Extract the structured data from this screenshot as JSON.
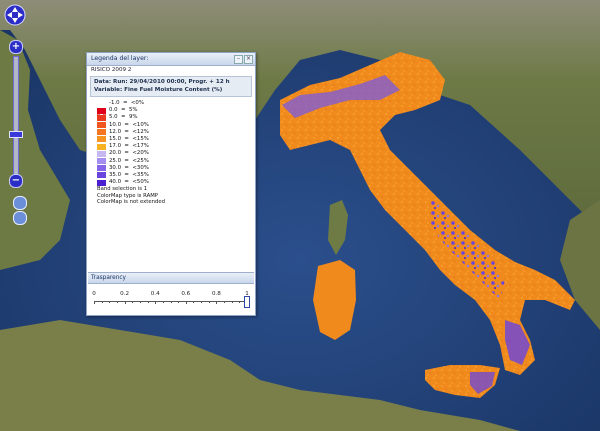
{
  "map": {
    "sea_color": "#1f3f74",
    "land_color": "#6f7a43",
    "mountain_color": "#9a9a82",
    "fmc_orange": "#f08a1c",
    "fmc_blue": "#5a3fd0"
  },
  "nav": {
    "zoom_in": "+",
    "zoom_out": "−"
  },
  "legend_panel": {
    "title": "Legenda del layer:",
    "layer_name": "RISICO 2009 2",
    "info_line1": "Data: Run: 29/04/2010 00:00, Progr. + 12 h",
    "info_line2": "Variable: Fine Fuel Moisture Content (%)",
    "classes": [
      {
        "label": "-1.0  =  <0%",
        "color": "nodata"
      },
      {
        "label": "0.0  =  5%",
        "color": "#e0001a"
      },
      {
        "label": "5.0  =  9%",
        "color": "#ec3a1e"
      },
      {
        "label": "10.0  =  <10%",
        "color": "#f2561f"
      },
      {
        "label": "12.0  =  <12%",
        "color": "#f4741f"
      },
      {
        "label": "15.0  =  <15%",
        "color": "#f79320"
      },
      {
        "label": "17.0  =  <17%",
        "color": "#f7b224"
      },
      {
        "label": "20.0  =  <20%",
        "color": "#c8b8f2"
      },
      {
        "label": "25.0  =  <25%",
        "color": "#a48ef0"
      },
      {
        "label": "30.0  =  <30%",
        "color": "#8566e8"
      },
      {
        "label": "35.0  =  <35%",
        "color": "#6a44de"
      },
      {
        "label": "40.0  =  <50%",
        "color": "#4c1fd0"
      }
    ],
    "notes": [
      "Band selection is 1",
      "ColorMap type is RAMP",
      "ColorMap is not extended"
    ],
    "transparency_title": "Trasparency",
    "slider_labels": [
      "0",
      "0.2",
      "0.4",
      "0.6",
      "0.8",
      "1"
    ],
    "slider_value": 1.0
  }
}
